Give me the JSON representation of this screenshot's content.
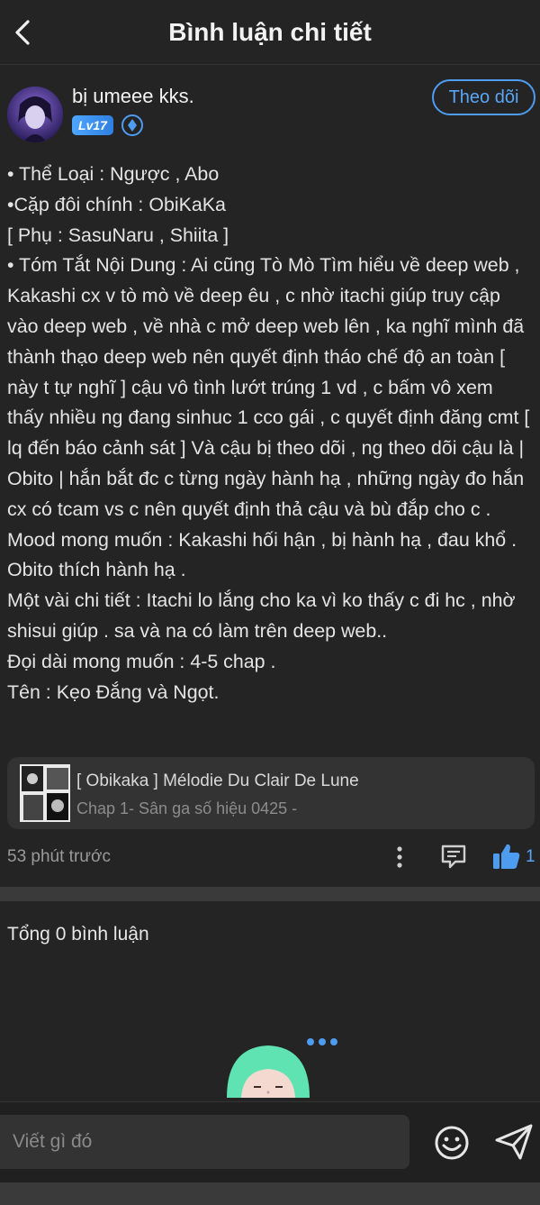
{
  "header": {
    "title": "Bình luận chi tiết"
  },
  "author": {
    "name": "bị umeee kks.",
    "level": "Lv17",
    "follow_label": "Theo dõi"
  },
  "post": {
    "lines": [
      "• Thể Loại : Ngược , Abo",
      "•Cặp đôi chính : ObiKaKa",
      "[ Phụ : SasuNaru , Shiita ]",
      "• Tóm Tắt Nội Dung : Ai cũng Tò Mò Tìm hiểu về deep web , Kakashi cx v tò mò về deep êu , c nhờ itachi giúp truy cập vào deep web , về nhà c mở deep web lên , ka nghĩ mình đã thành thạo deep web nên quyết định tháo chế độ an toàn [ này t tự nghĩ ] cậu vô tình lướt trúng 1 vd , c bấm vô xem thấy nhiều ng đang sinhuc 1 cco gái , c quyết định đăng cmt [ lq đến báo cảnh sát ] Và cậu bị theo dõi , ng theo dõi cậu là | Obito | hắn bắt đc c từng ngày hành hạ , những ngày đo hắn cx có tcam vs c nên quyết định thả cậu và bù đắp cho c .",
      "Mood mong muốn : Kakashi hối hận , bị hành hạ , đau khổ . Obito thích hành hạ .",
      "Một vài chi tiết : Itachi lo lắng cho ka vì ko thấy c đi hc , nhờ shisui giúp . sa và na có làm trên deep web..",
      "Đọi dài mong muốn : 4-5 chap .",
      "Tên : Kẹo Đắng và Ngọt."
    ]
  },
  "story": {
    "title": "[ Obikaka ] Mélodie Du Clair De Lune",
    "subtitle": "Chap 1- Sân ga số hiệu 0425 -"
  },
  "meta": {
    "time": "53 phút trước",
    "likes": "1"
  },
  "comments": {
    "total": "Tổng 0 bình luận"
  },
  "composer": {
    "placeholder": "Viết gì đó"
  },
  "colors": {
    "accent": "#4d9cf0",
    "background": "#242424",
    "card": "#333333"
  },
  "icons": [
    "back-arrow-icon",
    "diamond-icon",
    "more-vertical-icon",
    "reply-icon",
    "thumbs-up-icon",
    "emoji-icon",
    "send-icon"
  ]
}
